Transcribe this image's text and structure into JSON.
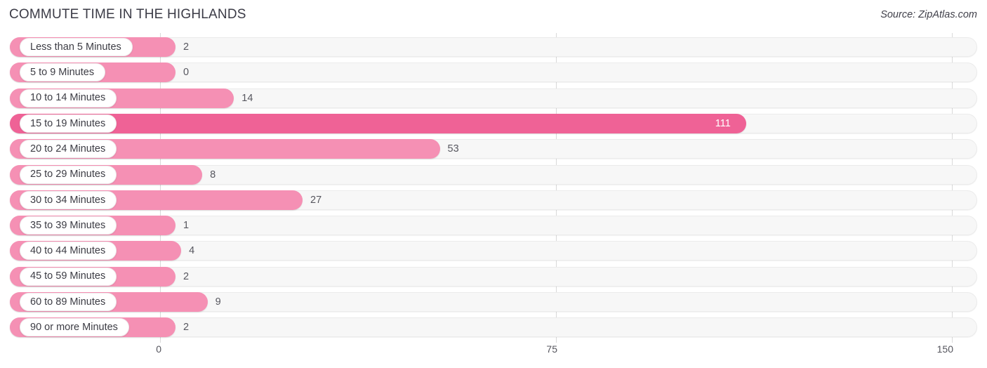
{
  "header": {
    "title": "COMMUTE TIME IN THE HIGHLANDS",
    "source": "Source: ZipAtlas.com"
  },
  "colors": {
    "bar": "#f590b4",
    "bar_highlight": "#ef6296",
    "track": "#f7f7f7",
    "text": "#3c3c44",
    "gridline": "#d9d9d9"
  },
  "chart_data": {
    "type": "bar",
    "orientation": "horizontal",
    "title": "COMMUTE TIME IN THE HIGHLANDS",
    "xlabel": "",
    "ylabel": "",
    "xlim": [
      0,
      150
    ],
    "ticks": [
      "0",
      "75",
      "150"
    ],
    "tick_values": [
      0,
      75,
      150
    ],
    "grid": true,
    "legend": null,
    "highlight_category": "15 to 19 Minutes",
    "categories": [
      "Less than 5 Minutes",
      "5 to 9 Minutes",
      "10 to 14 Minutes",
      "15 to 19 Minutes",
      "20 to 24 Minutes",
      "25 to 29 Minutes",
      "30 to 34 Minutes",
      "35 to 39 Minutes",
      "40 to 44 Minutes",
      "45 to 59 Minutes",
      "60 to 89 Minutes",
      "90 or more Minutes"
    ],
    "values": [
      2,
      0,
      14,
      111,
      53,
      8,
      27,
      1,
      4,
      2,
      9,
      2
    ],
    "value_labels": [
      "2",
      "0",
      "14",
      "111",
      "53",
      "8",
      "27",
      "1",
      "4",
      "2",
      "9",
      "2"
    ]
  }
}
